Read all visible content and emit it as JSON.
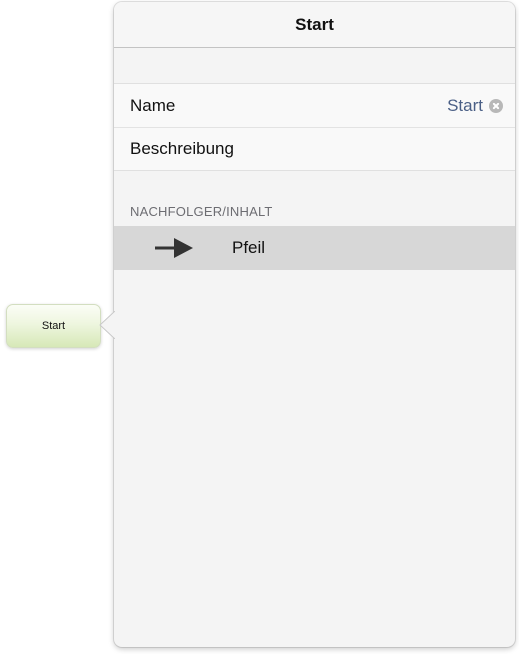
{
  "diagram": {
    "node_label": "Start"
  },
  "popover": {
    "title": "Start",
    "properties": [
      {
        "label": "Name",
        "value": "Start",
        "clearable": true
      },
      {
        "label": "Beschreibung",
        "value": ""
      }
    ],
    "section_header": "NACHFOLGER/INHALT",
    "successors": [
      {
        "label": "Pfeil",
        "icon": "right-arrow-icon"
      }
    ]
  },
  "colors": {
    "value_text": "#4a5f86",
    "selected_row": "#d7d7d7",
    "node_gradient_bottom": "#d7e8b7"
  }
}
